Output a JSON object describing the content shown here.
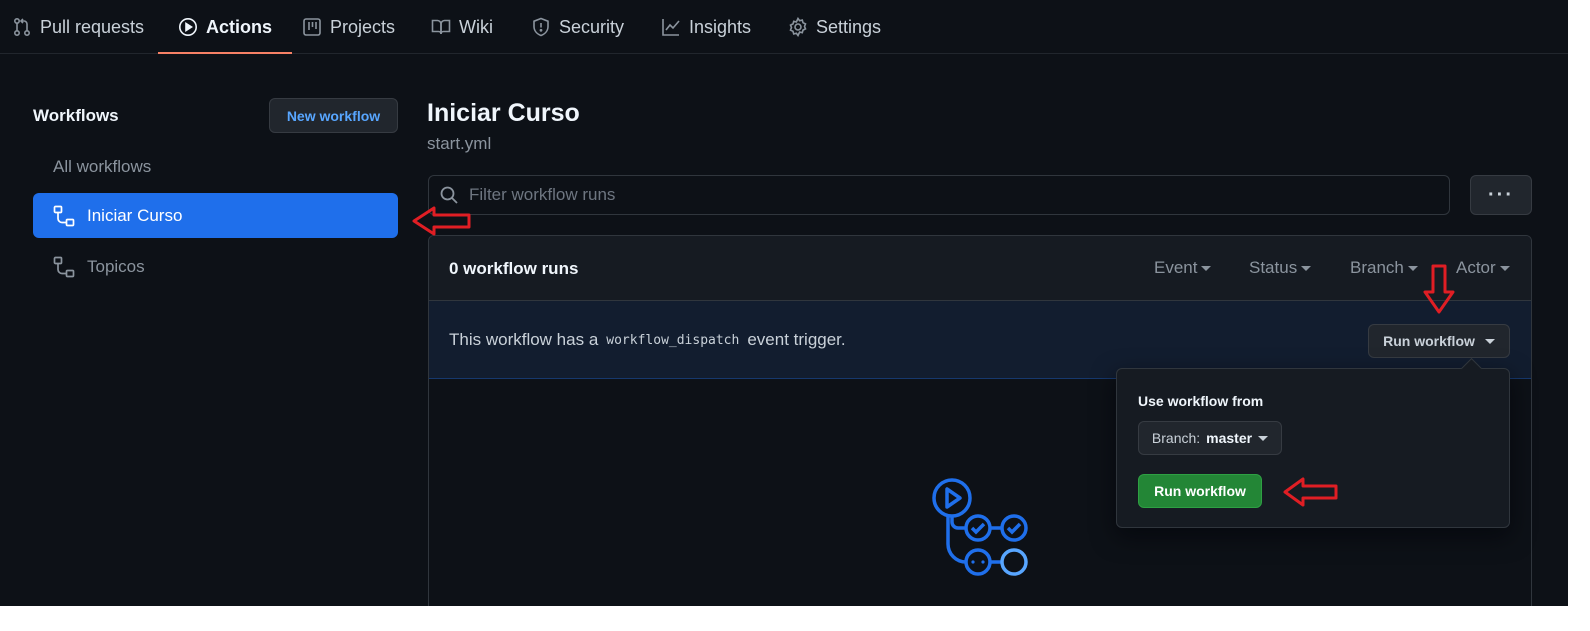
{
  "nav": {
    "tabs": [
      {
        "label": "Pull requests",
        "icon": "pull-request-icon"
      },
      {
        "label": "Actions",
        "icon": "play-icon",
        "active": true
      },
      {
        "label": "Projects",
        "icon": "project-icon"
      },
      {
        "label": "Wiki",
        "icon": "book-icon"
      },
      {
        "label": "Security",
        "icon": "shield-icon"
      },
      {
        "label": "Insights",
        "icon": "graph-icon"
      },
      {
        "label": "Settings",
        "icon": "gear-icon"
      }
    ],
    "active_underline_color": "#f78166"
  },
  "sidebar": {
    "title": "Workflows",
    "new_workflow_label": "New workflow",
    "items": [
      {
        "label": "All workflows"
      },
      {
        "label": "Iniciar Curso",
        "icon": "workflow-icon",
        "active": true
      },
      {
        "label": "Topicos",
        "icon": "workflow-icon"
      }
    ]
  },
  "main": {
    "title": "Iniciar Curso",
    "file": "start.yml",
    "filter_placeholder": "Filter workflow runs",
    "more_label": "···",
    "runs_count": "0 workflow runs",
    "filters": [
      "Event",
      "Status",
      "Branch",
      "Actor"
    ],
    "dispatch": {
      "prefix": "This workflow has a",
      "code": "workflow_dispatch",
      "suffix": "event trigger."
    },
    "run_workflow_label": "Run workflow",
    "popover": {
      "title": "Use workflow from",
      "branch_prefix": "Branch:",
      "branch_value": "master",
      "run_label": "Run workflow"
    }
  },
  "colors": {
    "background": "#0d1117",
    "accent": "#1f6feb",
    "success": "#238636",
    "annotation": "#e01e24"
  }
}
